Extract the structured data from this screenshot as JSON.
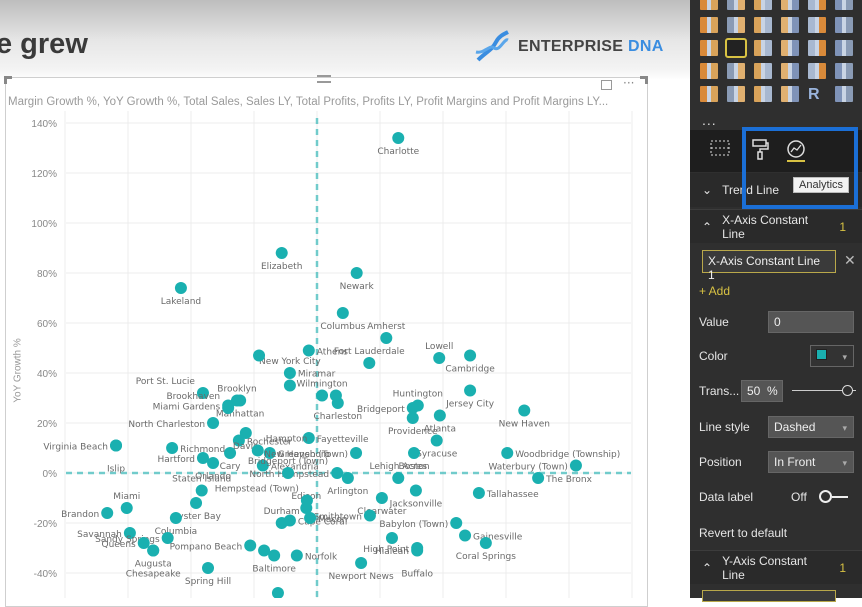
{
  "page": {
    "title": "e grew",
    "logo": {
      "word1": "ENTERPRISE",
      "word2": "DNA"
    }
  },
  "visual": {
    "header": "Margin Growth %, YoY Growth %, Total Sales, Sales LY, Total Profits, Profits LY, Profit Margins and Profit Margins LY...",
    "focus_icon": "focus-mode-icon",
    "more_icon": "more-options-icon"
  },
  "chart_data": {
    "type": "scatter",
    "ylabel": "YoY Growth %",
    "xlabel": "",
    "ylim": [
      -40,
      140
    ],
    "xlim": [
      -4,
      5
    ],
    "yticks": [
      "140%",
      "120%",
      "100%",
      "80%",
      "60%",
      "40%",
      "20%",
      "0%",
      "-20%",
      "-40%"
    ],
    "grid": true,
    "x_constant_line": 0,
    "y_constant_line": 0,
    "marker_color": "#1ab0b0",
    "points": [
      [
        "Charlotte",
        1.29,
        134
      ],
      [
        "Elizabeth",
        -0.56,
        88
      ],
      [
        "Newark",
        0.63,
        80
      ],
      [
        "Lakeland",
        -2.16,
        74
      ],
      [
        "Columbus",
        0.41,
        64
      ],
      [
        "Amherst",
        1.1,
        54
      ],
      [
        "Lowell",
        1.94,
        46
      ],
      [
        "Cambridge",
        2.43,
        47
      ],
      [
        "Athens",
        -0.13,
        49
      ],
      [
        "New York City",
        -0.43,
        40
      ],
      [
        "",
        -0.92,
        47
      ],
      [
        "Fort Lauderdale",
        0.83,
        44
      ],
      [
        "Port St. Lucie",
        -1.81,
        32
      ],
      [
        "Brooklyn",
        -1.27,
        29
      ],
      [
        "Miramar",
        -0.43,
        35
      ],
      [
        "Manhattan",
        -1.22,
        29
      ],
      [
        "Miami Gardens",
        -1.41,
        27
      ],
      [
        "Wilmington",
        0.08,
        31
      ],
      [
        "Charleston",
        0.33,
        28
      ],
      [
        "",
        0.3,
        31
      ],
      [
        "Huntington",
        1.6,
        27
      ],
      [
        "Jersey City",
        2.43,
        33
      ],
      [
        "Bridgeport",
        1.52,
        26
      ],
      [
        "Providence",
        1.52,
        22
      ],
      [
        "Atlanta",
        1.95,
        23
      ],
      [
        "New Haven",
        3.29,
        25
      ],
      [
        "North Charleston",
        -1.65,
        20
      ],
      [
        "Brookhaven",
        -1.41,
        26
      ],
      [
        "Rochester",
        -1.24,
        13
      ],
      [
        "Davie",
        -1.13,
        16
      ],
      [
        "Fayetteville",
        -0.13,
        14
      ],
      [
        "Hampton",
        -0.94,
        9
      ],
      [
        "Greensboro",
        -0.75,
        8
      ],
      [
        "Syracuse",
        1.9,
        13
      ],
      [
        "Boston",
        1.54,
        8
      ],
      [
        "New Haven (Town)",
        0.62,
        8
      ],
      [
        "North Hempstead",
        0.32,
        0
      ],
      [
        "Arlington",
        0.49,
        -2
      ],
      [
        "Virginia Beach",
        -3.19,
        11
      ],
      [
        "Islip",
        -3.19,
        11
      ],
      [
        "Richmond",
        -2.3,
        10
      ],
      [
        "Hartford",
        -1.81,
        6
      ],
      [
        "Orlando",
        -1.65,
        4
      ],
      [
        "Cary",
        -1.38,
        8
      ],
      [
        "Alexandria",
        -0.86,
        3
      ],
      [
        "Woodbridge (Township)",
        3.02,
        8
      ],
      [
        "Waterbury (Town)",
        4.11,
        3
      ],
      [
        "The Bronx",
        3.51,
        -2
      ],
      [
        "Lehigh Acres",
        1.29,
        -2
      ],
      [
        "Jacksonville",
        1.57,
        -7
      ],
      [
        "Tallahassee",
        2.57,
        -8
      ],
      [
        "Clearwater",
        1.03,
        -10
      ],
      [
        "Smithtown",
        0.84,
        -17
      ],
      [
        "Babylon (Town)",
        2.21,
        -20
      ],
      [
        "Gainesville",
        2.35,
        -25
      ],
      [
        "Hialeah",
        1.19,
        -26
      ],
      [
        "Coral Springs",
        2.68,
        -28
      ],
      [
        "High Point",
        1.59,
        -30
      ],
      [
        "Buffalo",
        1.59,
        -31
      ],
      [
        "Newport News",
        0.7,
        -36
      ],
      [
        "Bridgeport (Town)",
        -0.46,
        0
      ],
      [
        "Staten Island",
        -1.83,
        -7
      ],
      [
        "Oyster Bay",
        -1.92,
        -12
      ],
      [
        "Columbia",
        -2.24,
        -18
      ],
      [
        "Miami",
        -3.02,
        -14
      ],
      [
        "Brandon",
        -3.33,
        -16
      ],
      [
        "Savannah",
        -2.97,
        -24
      ],
      [
        "Sandy Springs",
        -2.37,
        -26
      ],
      [
        "Queens",
        -2.75,
        -28
      ],
      [
        "Augusta",
        -2.6,
        -31
      ],
      [
        "Chesapeake",
        -2.6,
        -31
      ],
      [
        "Pompano Beach",
        -1.06,
        -29
      ],
      [
        "Spring Hill",
        -1.73,
        -38
      ],
      [
        "Baltimore",
        -0.68,
        -33
      ],
      [
        "",
        -0.84,
        -31
      ],
      [
        "Durham",
        -0.56,
        -20
      ],
      [
        "Cape Coral",
        -0.43,
        -19
      ],
      [
        "Edison",
        -0.17,
        -14
      ],
      [
        "Macon",
        -0.11,
        -18
      ],
      [
        "Hempstead (Town)",
        -0.16,
        -11
      ],
      [
        "Norfolk",
        -0.32,
        -33
      ],
      [
        "",
        -0.62,
        -48
      ]
    ]
  },
  "panel": {
    "viz_icons": [
      "stacked-bar",
      "stacked-column",
      "clustered-bar",
      "clustered-column",
      "100-bar",
      "100-column",
      "line",
      "area",
      "stacked-area",
      "line-column",
      "line-clustered",
      "ribbon",
      "waterfall",
      "scatter",
      "pie",
      "donut",
      "treemap",
      "map",
      "filled-map",
      "shape-map",
      "funnel",
      "gauge",
      "card",
      "multi-row-card",
      "kpi",
      "slicer",
      "table",
      "matrix",
      "r-visual",
      "globe"
    ],
    "more": "...",
    "tabs": [
      {
        "name": "fields-icon"
      },
      {
        "name": "format-paint-roller-icon"
      },
      {
        "name": "analytics-icon"
      }
    ],
    "tooltip": "Analytics",
    "trend_line": "Trend Line",
    "x_axis_section": {
      "label": "X-Axis Constant Line",
      "count": "1"
    },
    "line_name": "X-Axis Constant Line 1",
    "add": "+ Add",
    "value_label": "Value",
    "value": "0",
    "color_label": "Color",
    "color": "#1ab0b0",
    "trans_label": "Trans...",
    "trans_value": "50",
    "trans_unit": "%",
    "transparency_percent": 50,
    "line_style_label": "Line style",
    "line_style": "Dashed",
    "position_label": "Position",
    "position": "In Front",
    "data_label_label": "Data label",
    "data_label_state": "Off",
    "revert": "Revert to default",
    "y_axis_section": {
      "label": "Y-Axis Constant Line",
      "count": "1"
    }
  }
}
